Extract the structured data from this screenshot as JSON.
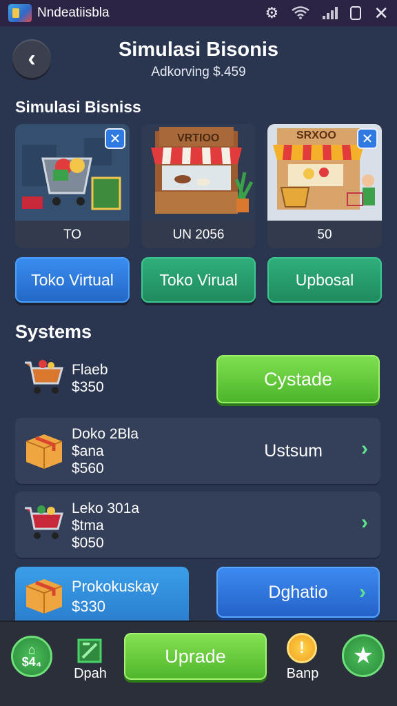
{
  "status_bar": {
    "app_title": "Nndeatiisbla",
    "icons": [
      "app-icon",
      "settings-gear-icon",
      "wifi-signal-icon",
      "cellular-signal-icon",
      "phone-outline-icon",
      "close-x-icon"
    ]
  },
  "header": {
    "title": "Simulasi Bisonis",
    "subtitle": "Adkorving $.459"
  },
  "business_section": {
    "title": "Simulasi Bisniss",
    "cards": [
      {
        "sign": "",
        "value": "TO",
        "button": "Toko Virtual",
        "has_close": true
      },
      {
        "sign": "VRTIOO",
        "value": "UN 2056",
        "button": "Toko Virual",
        "has_close": false
      },
      {
        "sign": "SRXOO",
        "value": "50",
        "button": "Upbosal",
        "has_close": true
      }
    ]
  },
  "systems_section": {
    "title": "Systems",
    "rows": [
      {
        "name": "Flaeb",
        "line2": "$350",
        "line3": "",
        "action": "Cystade",
        "icon": "shopping-cart-icon"
      },
      {
        "name": "Doko 2Bla",
        "line2": "$ana",
        "line3": "$560",
        "action": "Ustsum",
        "icon": "box-icon"
      },
      {
        "name": "Leko 301a",
        "line2": "$tma",
        "line3": "$050",
        "action": "",
        "icon": "shopping-cart-icon"
      },
      {
        "name": "Prokokuskay",
        "line2": "$330",
        "line3": "",
        "action": "Dghatio",
        "icon": "box-icon"
      }
    ]
  },
  "bottom_bar": {
    "money": "$4₄",
    "map_label": "Dpah",
    "upgrade_label": "Uprade",
    "bonus_label": "Banp",
    "icons": [
      "home-icon",
      "map-icon",
      "coin-exclamation-icon",
      "star-icon"
    ]
  },
  "colors": {
    "background": "#2a3650",
    "status_bar": "#2d2344",
    "primary_green": "#5cc433",
    "primary_blue": "#2f7ae0",
    "teal_green": "#27a06c",
    "chevron_green": "#5ee48a"
  }
}
